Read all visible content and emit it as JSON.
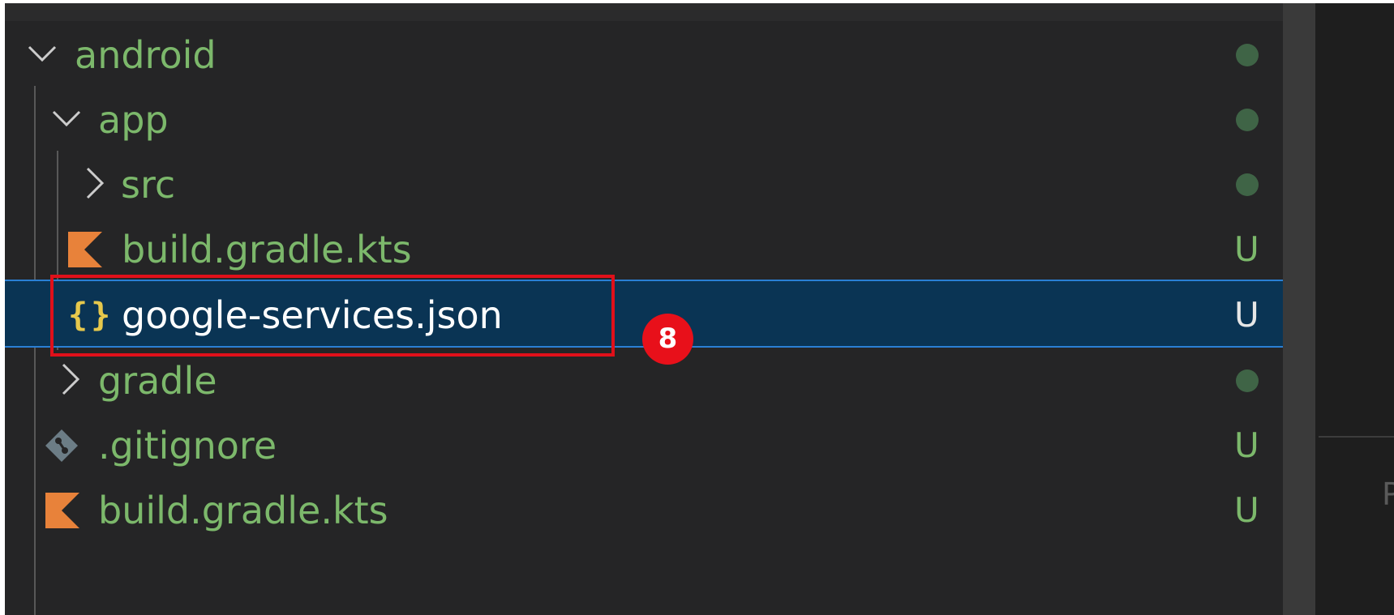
{
  "tree": {
    "items": [
      {
        "label": "android",
        "kind": "folder",
        "expanded": true,
        "status": "dot",
        "status_color": "#3f6446"
      },
      {
        "label": "app",
        "kind": "folder",
        "expanded": true,
        "status": "dot",
        "status_color": "#3f6446"
      },
      {
        "label": "src",
        "kind": "folder",
        "expanded": false,
        "status": "dot",
        "status_color": "#3f6446"
      },
      {
        "label": "build.gradle.kts",
        "kind": "file",
        "icon": "kotlin-icon",
        "status": "U"
      },
      {
        "label": "google-services.json",
        "kind": "file",
        "icon": "json-braces-icon",
        "status": "U",
        "selected": true
      },
      {
        "label": "gradle",
        "kind": "folder",
        "expanded": false,
        "status": "dot",
        "status_color": "#3f6446"
      },
      {
        "label": ".gitignore",
        "kind": "file",
        "icon": "git-icon",
        "status": "U"
      },
      {
        "label": "build.gradle.kts",
        "kind": "file",
        "icon": "kotlin-icon",
        "status": "U"
      }
    ],
    "json_icon_glyph": "{}"
  },
  "annotation": {
    "step_number": "8",
    "box_color": "#e0101a",
    "badge_color": "#e8101a"
  },
  "right_pane": {
    "peek_letter": "P"
  },
  "colors": {
    "background": "#252526",
    "untracked_text": "#7cb86b",
    "selected_bg": "#0a3454",
    "selected_border": "#2a7fd4",
    "kotlin_orange": "#e8823a",
    "json_yellow": "#e6c84c",
    "git_gray": "#6c7d86"
  }
}
